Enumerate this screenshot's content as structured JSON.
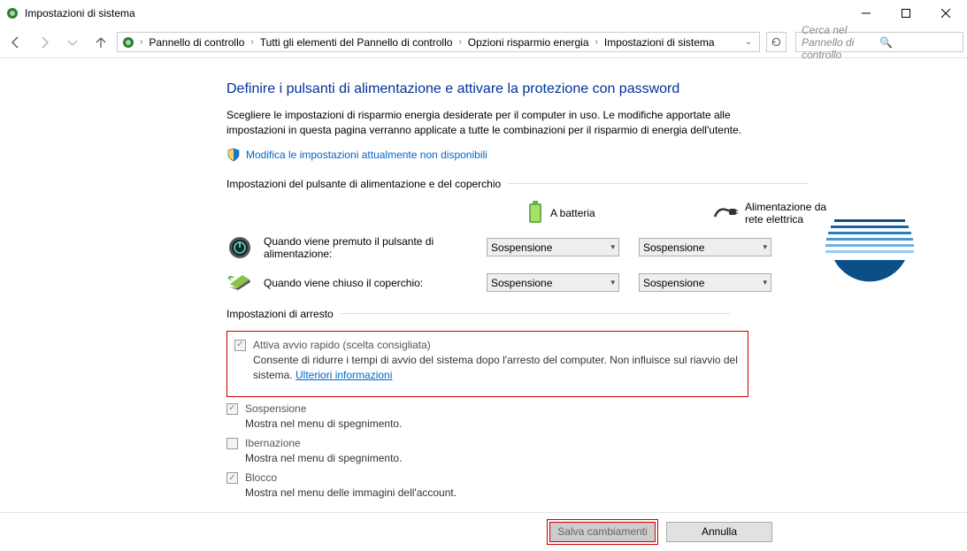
{
  "window": {
    "title": "Impostazioni di sistema"
  },
  "breadcrumbs": {
    "b0": "Pannello di controllo",
    "b1": "Tutti gli elementi del Pannello di controllo",
    "b2": "Opzioni risparmio energia",
    "b3": "Impostazioni di sistema"
  },
  "search": {
    "placeholder": "Cerca nel Pannello di controllo"
  },
  "page": {
    "heading": "Definire i pulsanti di alimentazione e attivare la protezione con password",
    "description": "Scegliere le impostazioni di risparmio energia desiderate per il computer in uso. Le modifiche apportate alle impostazioni in questa pagina verranno applicate a tutte le combinazioni per il risparmio di energia dell'utente.",
    "admin_link": "Modifica le impostazioni attualmente non disponibili",
    "section1": "Impostazioni del pulsante di alimentazione e del coperchio",
    "col_battery": "A batteria",
    "col_ac": "Alimentazione da rete elettrica",
    "row1_label": "Quando viene premuto il pulsante di alimentazione:",
    "row2_label": "Quando viene chiuso il coperchio:",
    "row1_batt": "Sospensione",
    "row1_ac": "Sospensione",
    "row2_batt": "Sospensione",
    "row2_ac": "Sospensione",
    "section2": "Impostazioni di arresto",
    "fast_startup_title": "Attiva avvio rapido (scelta consigliata)",
    "fast_startup_desc": "Consente di ridurre i tempi di avvio del sistema dopo l'arresto del computer. Non influisce sul riavvio del sistema. ",
    "fast_startup_link": "Ulteriori informazioni",
    "suspend_title": "Sospensione",
    "suspend_desc": "Mostra nel menu di spegnimento.",
    "hibernate_title": "Ibernazione",
    "hibernate_desc": "Mostra nel menu di spegnimento.",
    "lock_title": "Blocco",
    "lock_desc": "Mostra nel menu delle immagini dell'account."
  },
  "footer": {
    "save": "Salva cambiamenti",
    "cancel": "Annulla"
  }
}
